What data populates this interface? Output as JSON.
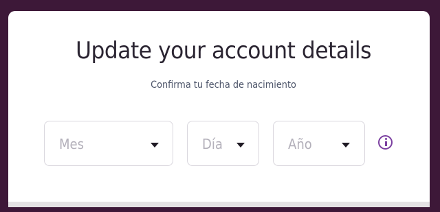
{
  "card": {
    "title": "Update your account details",
    "subtitle": "Confirma tu fecha de nacimiento"
  },
  "birthdate": {
    "month": {
      "placeholder": "Mes",
      "icon": "caret-down-icon"
    },
    "day": {
      "placeholder": "Día",
      "icon": "caret-down-icon"
    },
    "year": {
      "placeholder": "Año",
      "icon": "caret-down-icon"
    },
    "info_icon": "info-icon"
  },
  "colors": {
    "background": "#3d1838",
    "card": "#ffffff",
    "accent": "#7b3fa0",
    "title_text": "#2b2532",
    "placeholder_text": "#b3b0ba",
    "border": "#d9d6dd"
  }
}
